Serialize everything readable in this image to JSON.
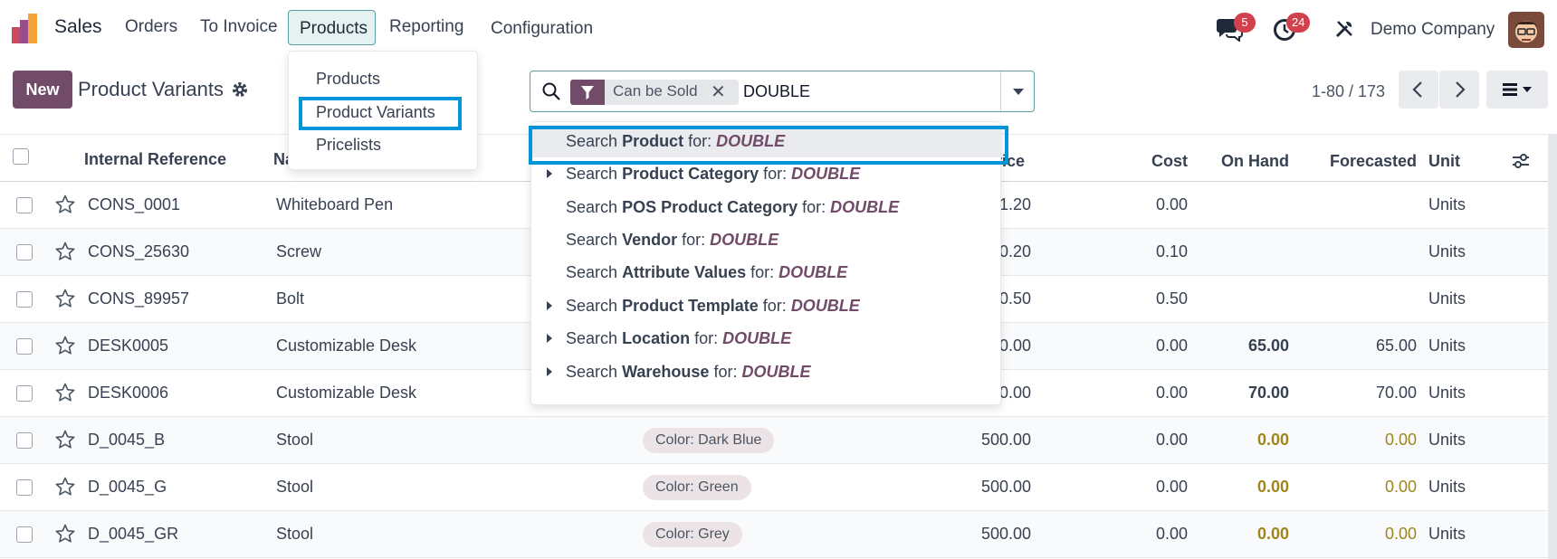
{
  "navbar": {
    "app_name": "Sales",
    "menu": [
      "Orders",
      "To Invoice",
      "Products",
      "Reporting",
      "Configuration"
    ],
    "messages_badge": "5",
    "activities_badge": "24",
    "company": "Demo Company"
  },
  "products_menu": {
    "items": [
      "Products",
      "Product Variants",
      "Pricelists"
    ],
    "highlighted": "Product Variants"
  },
  "control_panel": {
    "new_label": "New",
    "title": "Product Variants",
    "pager": "1-80 / 173"
  },
  "search": {
    "facet_label": "Can be Sold",
    "facet_remove": "✕",
    "value": "DOUBLE"
  },
  "autocomplete": {
    "prefix": "Search",
    "suffix": "for:",
    "term": "DOUBLE",
    "items": [
      {
        "field": "Product",
        "expandable": false,
        "active": true
      },
      {
        "field": "Product Category",
        "expandable": true
      },
      {
        "field": "POS Product Category",
        "expandable": false
      },
      {
        "field": "Vendor",
        "expandable": false
      },
      {
        "field": "Attribute Values",
        "expandable": false
      },
      {
        "field": "Product Template",
        "expandable": true
      },
      {
        "field": "Location",
        "expandable": true
      },
      {
        "field": "Warehouse",
        "expandable": true
      }
    ]
  },
  "table": {
    "headers": {
      "internal_reference": "Internal Reference",
      "name": "Na",
      "price": "rice",
      "cost": "Cost",
      "on_hand": "On Hand",
      "forecasted": "Forecasted",
      "unit": "Unit"
    },
    "rows": [
      {
        "ref": "CONS_0001",
        "name": "Whiteboard Pen",
        "tag": "",
        "price": "1.20",
        "cost": "0.00",
        "on_hand": "",
        "forecasted": "",
        "unit": "Units",
        "warn": false
      },
      {
        "ref": "CONS_25630",
        "name": "Screw",
        "tag": "",
        "price": "0.20",
        "cost": "0.10",
        "on_hand": "",
        "forecasted": "",
        "unit": "Units",
        "warn": false
      },
      {
        "ref": "CONS_89957",
        "name": "Bolt",
        "tag": "",
        "price": "0.50",
        "cost": "0.50",
        "on_hand": "",
        "forecasted": "",
        "unit": "Units",
        "warn": false
      },
      {
        "ref": "DESK0005",
        "name": "Customizable Desk",
        "tag": "",
        "price": "0.00",
        "cost": "0.00",
        "on_hand": "65.00",
        "forecasted": "65.00",
        "unit": "Units",
        "warn": false
      },
      {
        "ref": "DESK0006",
        "name": "Customizable Desk",
        "tag": "",
        "price": "0.00",
        "cost": "0.00",
        "on_hand": "70.00",
        "forecasted": "70.00",
        "unit": "Units",
        "warn": false
      },
      {
        "ref": "D_0045_B",
        "name": "Stool",
        "tag": "Color: Dark Blue",
        "price": "500.00",
        "cost": "0.00",
        "on_hand": "0.00",
        "forecasted": "0.00",
        "unit": "Units",
        "warn": true
      },
      {
        "ref": "D_0045_G",
        "name": "Stool",
        "tag": "Color: Green",
        "price": "500.00",
        "cost": "0.00",
        "on_hand": "0.00",
        "forecasted": "0.00",
        "unit": "Units",
        "warn": true
      },
      {
        "ref": "D_0045_GR",
        "name": "Stool",
        "tag": "Color: Grey",
        "price": "500.00",
        "cost": "0.00",
        "on_hand": "0.00",
        "forecasted": "0.00",
        "unit": "Units",
        "warn": true
      }
    ]
  },
  "colors": {
    "brand": "#714b67",
    "highlight": "#0095d9",
    "warning": "#a0851b",
    "badge": "#d23f4d"
  }
}
